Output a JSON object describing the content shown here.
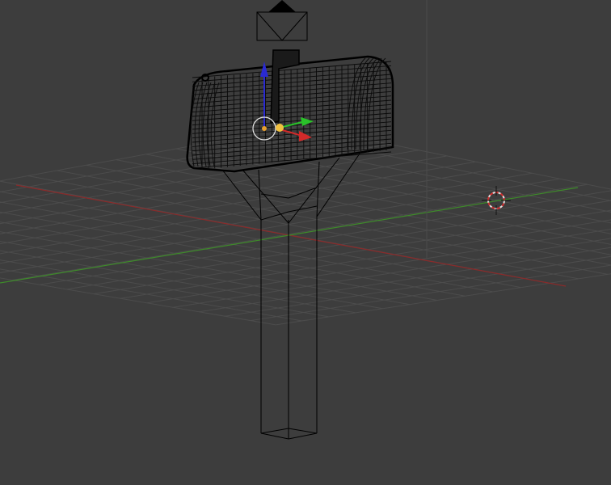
{
  "viewport": {
    "mode": "3d-view-wireframe",
    "background": "#3d3d3d",
    "grid_color": "#4c4c4c",
    "x_axis_color": "#8a2a2a",
    "y_axis_color": "#3e8a2a",
    "wire_color": "#000000"
  },
  "scene": {
    "objects": [
      {
        "name": "mailbox",
        "display": "wireframe",
        "selected": true
      },
      {
        "name": "camera",
        "display": "wireframe",
        "selected": false
      }
    ],
    "cursor_icon": "3d-cursor-icon"
  },
  "manipulator": {
    "x_color": "#d22a2a",
    "y_color": "#2ac22a",
    "z_color": "#2a2ad2",
    "origin_color": "#e8a030"
  }
}
